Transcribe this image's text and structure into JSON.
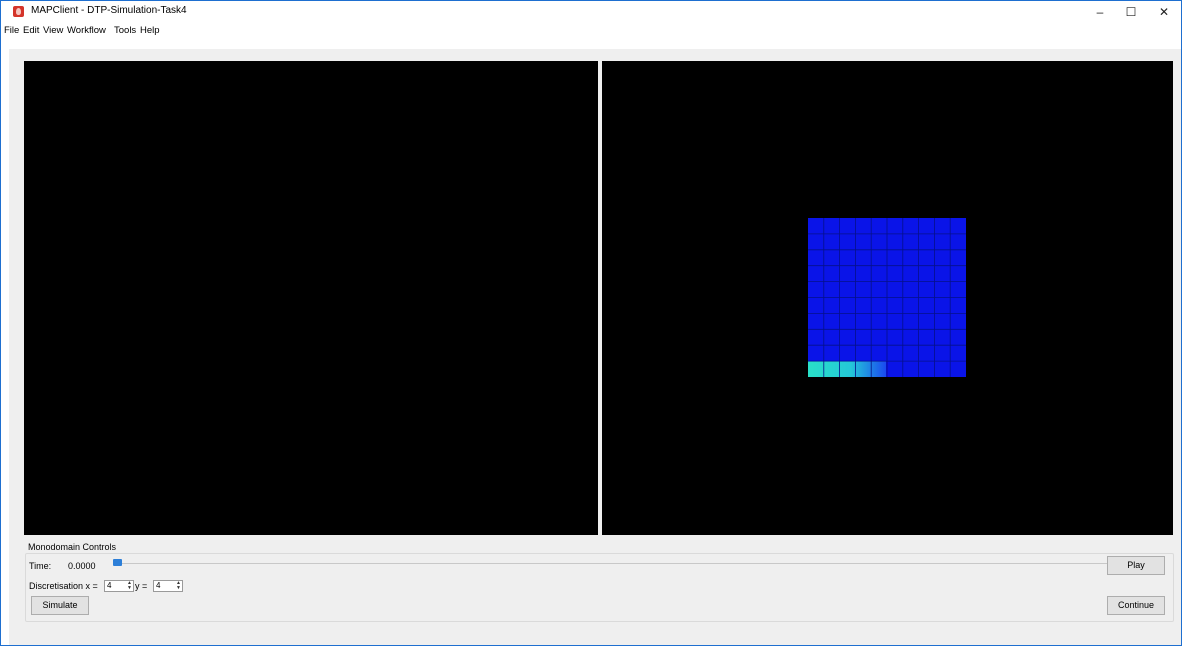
{
  "window": {
    "title": "MAPClient - DTP-Simulation-Task4",
    "buttons": {
      "minimize": "–",
      "maximize": "☐",
      "close": "✕"
    }
  },
  "menubar": [
    "File",
    "Edit",
    "View",
    "Workflow",
    "Tools",
    "Help"
  ],
  "monodomain": {
    "title": "Monodomain Controls",
    "time_label": "Time:",
    "time_value": "0.0000",
    "time_position": 0.0,
    "discretisation_label": "Discretisation x =",
    "x_value": "4",
    "y_label": "y =",
    "y_value": "4",
    "simulate_label": "Simulate",
    "play_label": "Play",
    "continue_label": "Continue"
  },
  "colors": {
    "window_border": "#1e6fd0",
    "scene_background": "#000000",
    "mesh_blue": "#0a14e8",
    "mesh_cyan": "#29e0c8",
    "slider_accent": "#2d7fd8"
  }
}
